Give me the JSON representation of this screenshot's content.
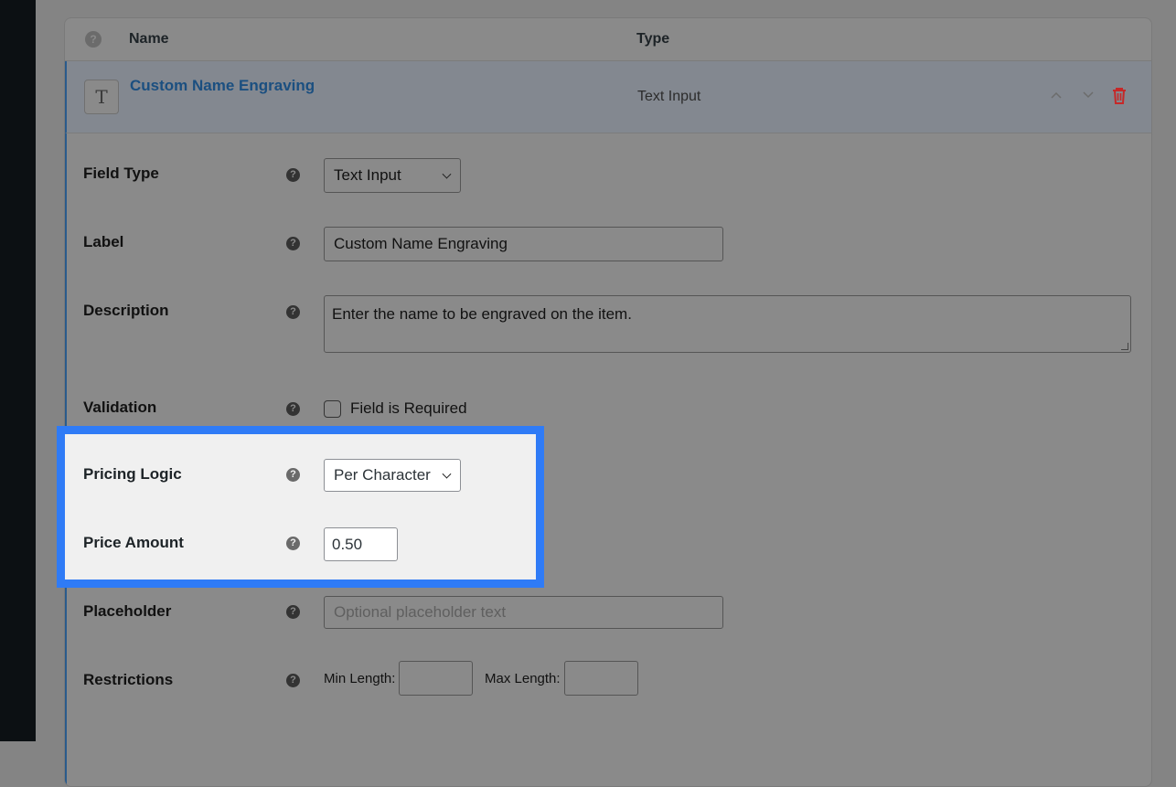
{
  "header": {
    "name_col": "Name",
    "type_col": "Type"
  },
  "field_row": {
    "icon_letter": "T",
    "title": "Custom Name Engraving",
    "type": "Text Input"
  },
  "form": {
    "field_type": {
      "label": "Field Type",
      "value": "Text Input"
    },
    "label_field": {
      "label": "Label",
      "value": "Custom Name Engraving"
    },
    "description": {
      "label": "Description",
      "value": "Enter the name to be engraved on the item."
    },
    "validation": {
      "label": "Validation",
      "checkbox_label": "Field is Required",
      "checked": false
    },
    "pricing_logic": {
      "label": "Pricing Logic",
      "value": "Per Character"
    },
    "price_amount": {
      "label": "Price Amount",
      "value": "0.50"
    },
    "placeholder": {
      "label": "Placeholder",
      "placeholder": "Optional placeholder text"
    },
    "restrictions": {
      "label": "Restrictions",
      "min_label": "Min Length:",
      "max_label": "Max Length:"
    }
  },
  "colors": {
    "highlight_border": "#2f7bf6",
    "delete_icon": "#c62828",
    "title_link": "#1b4f80"
  }
}
